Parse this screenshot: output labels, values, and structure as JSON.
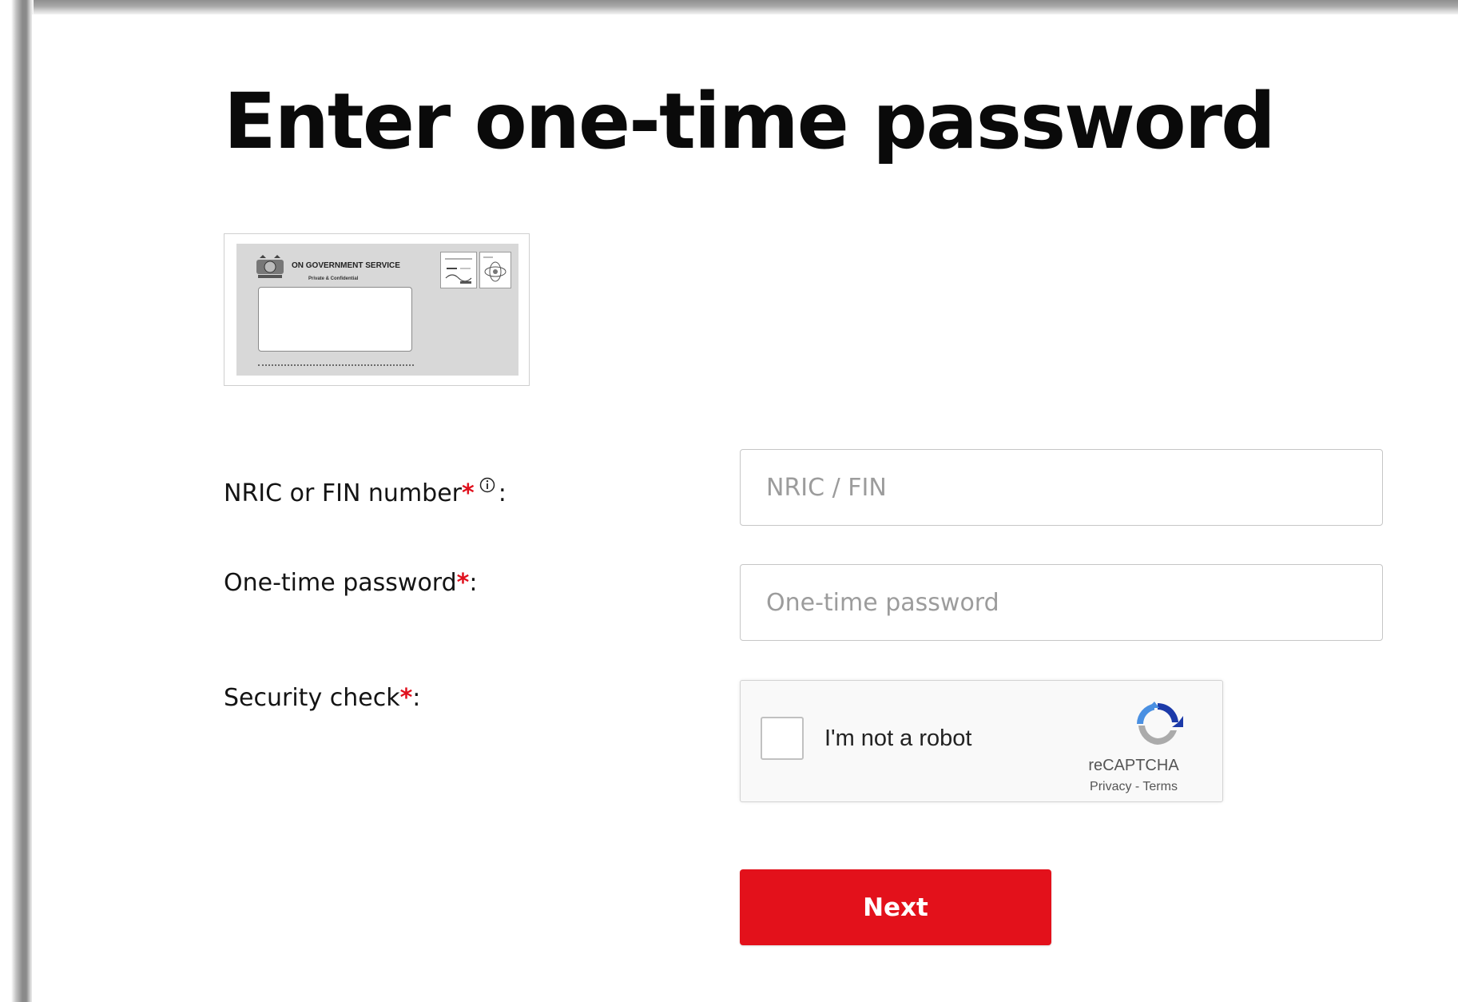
{
  "page": {
    "title": "Enter one-time password"
  },
  "envelope_image": {
    "header_text": "ON GOVERNMENT SERVICE",
    "sub_text": "Private & Confidential"
  },
  "form": {
    "nric": {
      "label": "NRIC or FIN number",
      "required_mark": "*",
      "suffix": ":",
      "placeholder": "NRIC / FIN",
      "value": ""
    },
    "otp": {
      "label": "One-time password",
      "required_mark": "*",
      "suffix": ":",
      "placeholder": "One-time password",
      "value": ""
    },
    "security": {
      "label": "Security check",
      "required_mark": "*",
      "suffix": ":"
    }
  },
  "recaptcha": {
    "checkbox_label": "I'm not a robot",
    "checked": false,
    "brand": "reCAPTCHA",
    "privacy_link": "Privacy",
    "separator": "-",
    "terms_link": "Terms"
  },
  "actions": {
    "next_label": "Next"
  },
  "colors": {
    "accent_red": "#e3111b",
    "required_red": "#e0101d",
    "title_text": "#0a0a0a",
    "placeholder": "#9c9c9c"
  },
  "icons": {
    "info": "info-circle-icon",
    "recaptcha_logo": "recaptcha-logo-icon",
    "crest": "singapore-crest-icon"
  }
}
